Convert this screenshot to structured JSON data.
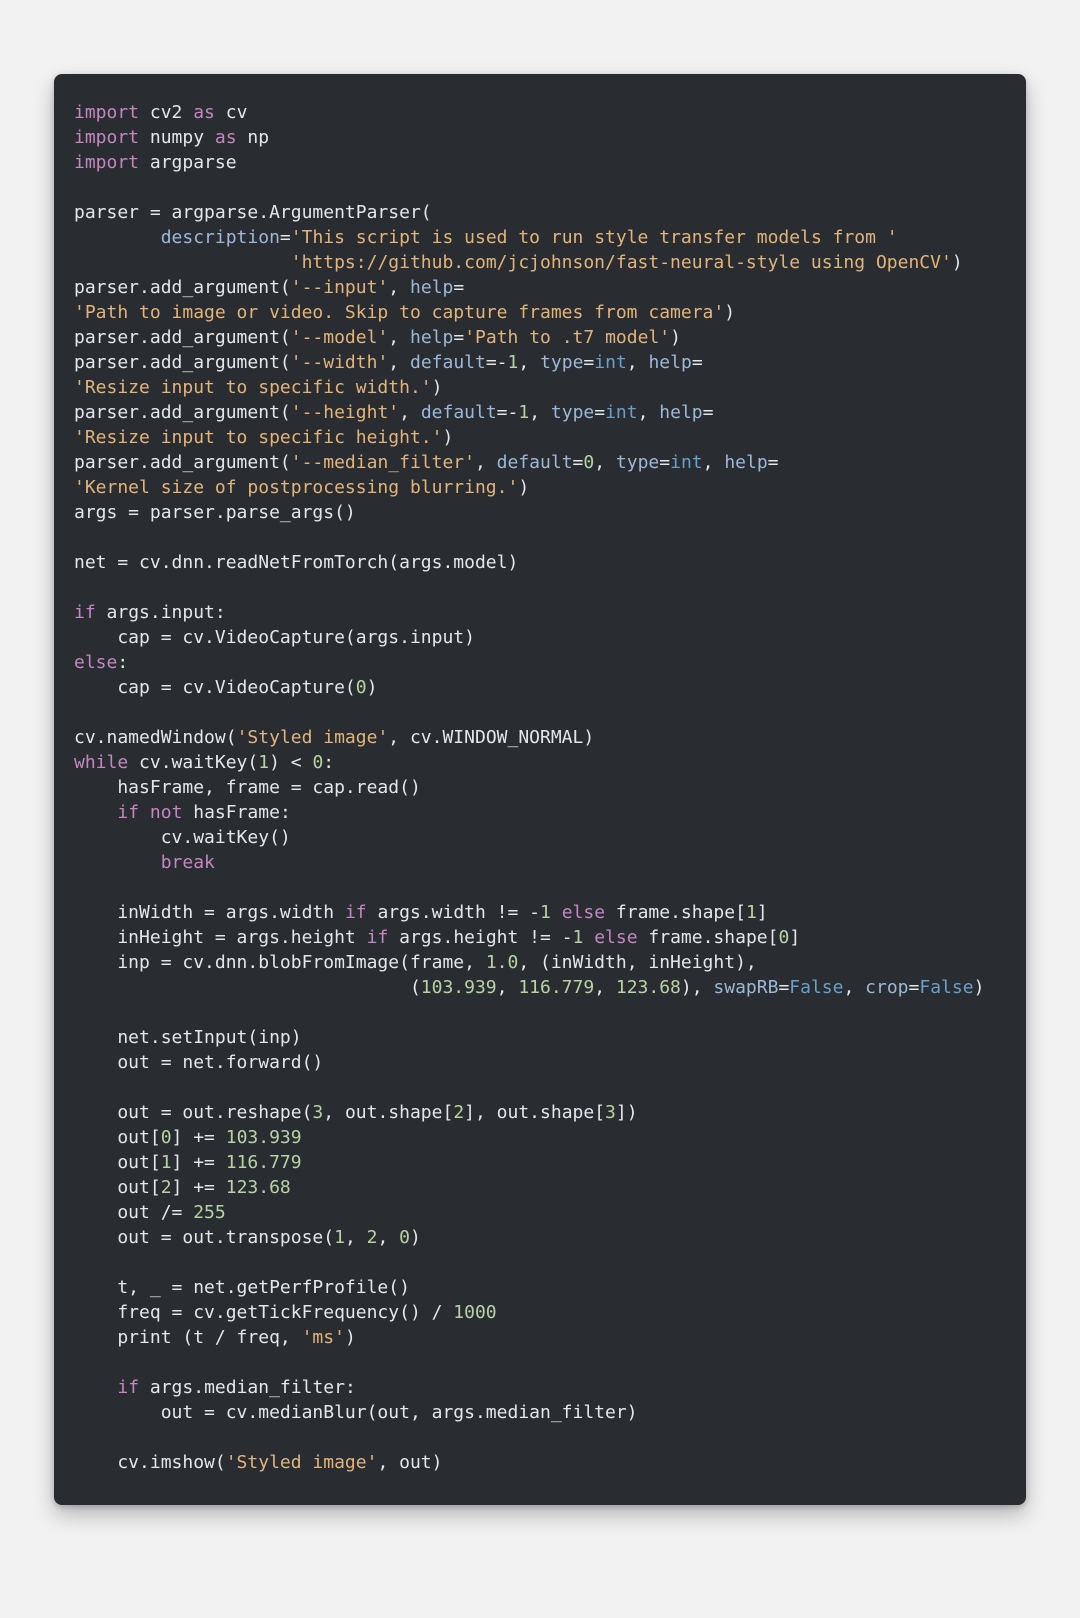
{
  "code": {
    "tokens": [
      {
        "c": "kw",
        "t": "import"
      },
      {
        "t": " cv2 "
      },
      {
        "c": "kw",
        "t": "as"
      },
      {
        "t": " cv\n"
      },
      {
        "c": "kw",
        "t": "import"
      },
      {
        "t": " numpy "
      },
      {
        "c": "kw",
        "t": "as"
      },
      {
        "t": " np\n"
      },
      {
        "c": "kw",
        "t": "import"
      },
      {
        "t": " argparse\n"
      },
      {
        "t": "\n"
      },
      {
        "t": "parser = argparse.ArgumentParser(\n"
      },
      {
        "t": "        "
      },
      {
        "c": "arg",
        "t": "description"
      },
      {
        "t": "="
      },
      {
        "c": "str",
        "t": "'This script is used to run style transfer models from '"
      },
      {
        "t": "\n"
      },
      {
        "t": "                    "
      },
      {
        "c": "str",
        "t": "'https://github.com/jcjohnson/fast-neural-style using OpenCV'"
      },
      {
        "t": ")\n"
      },
      {
        "t": "parser.add_argument("
      },
      {
        "c": "str",
        "t": "'--input'"
      },
      {
        "t": ", "
      },
      {
        "c": "arg",
        "t": "help"
      },
      {
        "t": "=\n"
      },
      {
        "c": "str",
        "t": "'Path to image or video. Skip to capture frames from camera'"
      },
      {
        "t": ")\n"
      },
      {
        "t": "parser.add_argument("
      },
      {
        "c": "str",
        "t": "'--model'"
      },
      {
        "t": ", "
      },
      {
        "c": "arg",
        "t": "help"
      },
      {
        "t": "="
      },
      {
        "c": "str",
        "t": "'Path to .t7 model'"
      },
      {
        "t": ")\n"
      },
      {
        "t": "parser.add_argument("
      },
      {
        "c": "str",
        "t": "'--width'"
      },
      {
        "t": ", "
      },
      {
        "c": "arg",
        "t": "default"
      },
      {
        "t": "=-"
      },
      {
        "c": "num",
        "t": "1"
      },
      {
        "t": ", "
      },
      {
        "c": "arg",
        "t": "type"
      },
      {
        "t": "="
      },
      {
        "c": "type",
        "t": "int"
      },
      {
        "t": ", "
      },
      {
        "c": "arg",
        "t": "help"
      },
      {
        "t": "=\n"
      },
      {
        "c": "str",
        "t": "'Resize input to specific width.'"
      },
      {
        "t": ")\n"
      },
      {
        "t": "parser.add_argument("
      },
      {
        "c": "str",
        "t": "'--height'"
      },
      {
        "t": ", "
      },
      {
        "c": "arg",
        "t": "default"
      },
      {
        "t": "=-"
      },
      {
        "c": "num",
        "t": "1"
      },
      {
        "t": ", "
      },
      {
        "c": "arg",
        "t": "type"
      },
      {
        "t": "="
      },
      {
        "c": "type",
        "t": "int"
      },
      {
        "t": ", "
      },
      {
        "c": "arg",
        "t": "help"
      },
      {
        "t": "=\n"
      },
      {
        "c": "str",
        "t": "'Resize input to specific height.'"
      },
      {
        "t": ")\n"
      },
      {
        "t": "parser.add_argument("
      },
      {
        "c": "str",
        "t": "'--median_filter'"
      },
      {
        "t": ", "
      },
      {
        "c": "arg",
        "t": "default"
      },
      {
        "t": "="
      },
      {
        "c": "num",
        "t": "0"
      },
      {
        "t": ", "
      },
      {
        "c": "arg",
        "t": "type"
      },
      {
        "t": "="
      },
      {
        "c": "type",
        "t": "int"
      },
      {
        "t": ", "
      },
      {
        "c": "arg",
        "t": "help"
      },
      {
        "t": "=\n"
      },
      {
        "c": "str",
        "t": "'Kernel size of postprocessing blurring.'"
      },
      {
        "t": ")\n"
      },
      {
        "t": "args = parser.parse_args()\n"
      },
      {
        "t": "\n"
      },
      {
        "t": "net = cv.dnn.readNetFromTorch(args.model)\n"
      },
      {
        "t": "\n"
      },
      {
        "c": "kw",
        "t": "if"
      },
      {
        "t": " args.input:\n"
      },
      {
        "t": "    cap = cv.VideoCapture(args.input)\n"
      },
      {
        "c": "kw",
        "t": "else"
      },
      {
        "t": ":\n"
      },
      {
        "t": "    cap = cv.VideoCapture("
      },
      {
        "c": "num",
        "t": "0"
      },
      {
        "t": ")\n"
      },
      {
        "t": "\n"
      },
      {
        "t": "cv.namedWindow("
      },
      {
        "c": "str",
        "t": "'Styled image'"
      },
      {
        "t": ", cv.WINDOW_NORMAL)\n"
      },
      {
        "c": "kw",
        "t": "while"
      },
      {
        "t": " cv.waitKey("
      },
      {
        "c": "num",
        "t": "1"
      },
      {
        "t": ") < "
      },
      {
        "c": "num",
        "t": "0"
      },
      {
        "t": ":\n"
      },
      {
        "t": "    hasFrame, frame = cap.read()\n"
      },
      {
        "t": "    "
      },
      {
        "c": "kw",
        "t": "if"
      },
      {
        "t": " "
      },
      {
        "c": "kw",
        "t": "not"
      },
      {
        "t": " hasFrame:\n"
      },
      {
        "t": "        cv.waitKey()\n"
      },
      {
        "t": "        "
      },
      {
        "c": "kw",
        "t": "break"
      },
      {
        "t": "\n"
      },
      {
        "t": "\n"
      },
      {
        "t": "    inWidth = args.width "
      },
      {
        "c": "kw",
        "t": "if"
      },
      {
        "t": " args.width != -"
      },
      {
        "c": "num",
        "t": "1"
      },
      {
        "t": " "
      },
      {
        "c": "kw",
        "t": "else"
      },
      {
        "t": " frame.shape["
      },
      {
        "c": "num",
        "t": "1"
      },
      {
        "t": "]\n"
      },
      {
        "t": "    inHeight = args.height "
      },
      {
        "c": "kw",
        "t": "if"
      },
      {
        "t": " args.height != -"
      },
      {
        "c": "num",
        "t": "1"
      },
      {
        "t": " "
      },
      {
        "c": "kw",
        "t": "else"
      },
      {
        "t": " frame.shape["
      },
      {
        "c": "num",
        "t": "0"
      },
      {
        "t": "]\n"
      },
      {
        "t": "    inp = cv.dnn.blobFromImage(frame, "
      },
      {
        "c": "num",
        "t": "1.0"
      },
      {
        "t": ", (inWidth, inHeight),\n"
      },
      {
        "t": "                               ("
      },
      {
        "c": "num",
        "t": "103.939"
      },
      {
        "t": ", "
      },
      {
        "c": "num",
        "t": "116.779"
      },
      {
        "t": ", "
      },
      {
        "c": "num",
        "t": "123.68"
      },
      {
        "t": "), "
      },
      {
        "c": "arg",
        "t": "swapRB"
      },
      {
        "t": "="
      },
      {
        "c": "bool",
        "t": "False"
      },
      {
        "t": ", "
      },
      {
        "c": "arg",
        "t": "crop"
      },
      {
        "t": "="
      },
      {
        "c": "bool",
        "t": "False"
      },
      {
        "t": ")\n"
      },
      {
        "t": "\n"
      },
      {
        "t": "    net.setInput(inp)\n"
      },
      {
        "t": "    out = net.forward()\n"
      },
      {
        "t": "\n"
      },
      {
        "t": "    out = out.reshape("
      },
      {
        "c": "num",
        "t": "3"
      },
      {
        "t": ", out.shape["
      },
      {
        "c": "num",
        "t": "2"
      },
      {
        "t": "], out.shape["
      },
      {
        "c": "num",
        "t": "3"
      },
      {
        "t": "])\n"
      },
      {
        "t": "    out["
      },
      {
        "c": "num",
        "t": "0"
      },
      {
        "t": "] += "
      },
      {
        "c": "num",
        "t": "103.939"
      },
      {
        "t": "\n"
      },
      {
        "t": "    out["
      },
      {
        "c": "num",
        "t": "1"
      },
      {
        "t": "] += "
      },
      {
        "c": "num",
        "t": "116.779"
      },
      {
        "t": "\n"
      },
      {
        "t": "    out["
      },
      {
        "c": "num",
        "t": "2"
      },
      {
        "t": "] += "
      },
      {
        "c": "num",
        "t": "123.68"
      },
      {
        "t": "\n"
      },
      {
        "t": "    out /= "
      },
      {
        "c": "num",
        "t": "255"
      },
      {
        "t": "\n"
      },
      {
        "t": "    out = out.transpose("
      },
      {
        "c": "num",
        "t": "1"
      },
      {
        "t": ", "
      },
      {
        "c": "num",
        "t": "2"
      },
      {
        "t": ", "
      },
      {
        "c": "num",
        "t": "0"
      },
      {
        "t": ")\n"
      },
      {
        "t": "\n"
      },
      {
        "t": "    t, _ = net.getPerfProfile()\n"
      },
      {
        "t": "    freq = cv.getTickFrequency() / "
      },
      {
        "c": "num",
        "t": "1000"
      },
      {
        "t": "\n"
      },
      {
        "t": "    print (t / freq, "
      },
      {
        "c": "str",
        "t": "'ms'"
      },
      {
        "t": ")\n"
      },
      {
        "t": "\n"
      },
      {
        "t": "    "
      },
      {
        "c": "kw",
        "t": "if"
      },
      {
        "t": " args.median_filter:\n"
      },
      {
        "t": "        out = cv.medianBlur(out, args.median_filter)\n"
      },
      {
        "t": "\n"
      },
      {
        "t": "    cv.imshow("
      },
      {
        "c": "str",
        "t": "'Styled image'"
      },
      {
        "t": ", out)"
      }
    ]
  }
}
